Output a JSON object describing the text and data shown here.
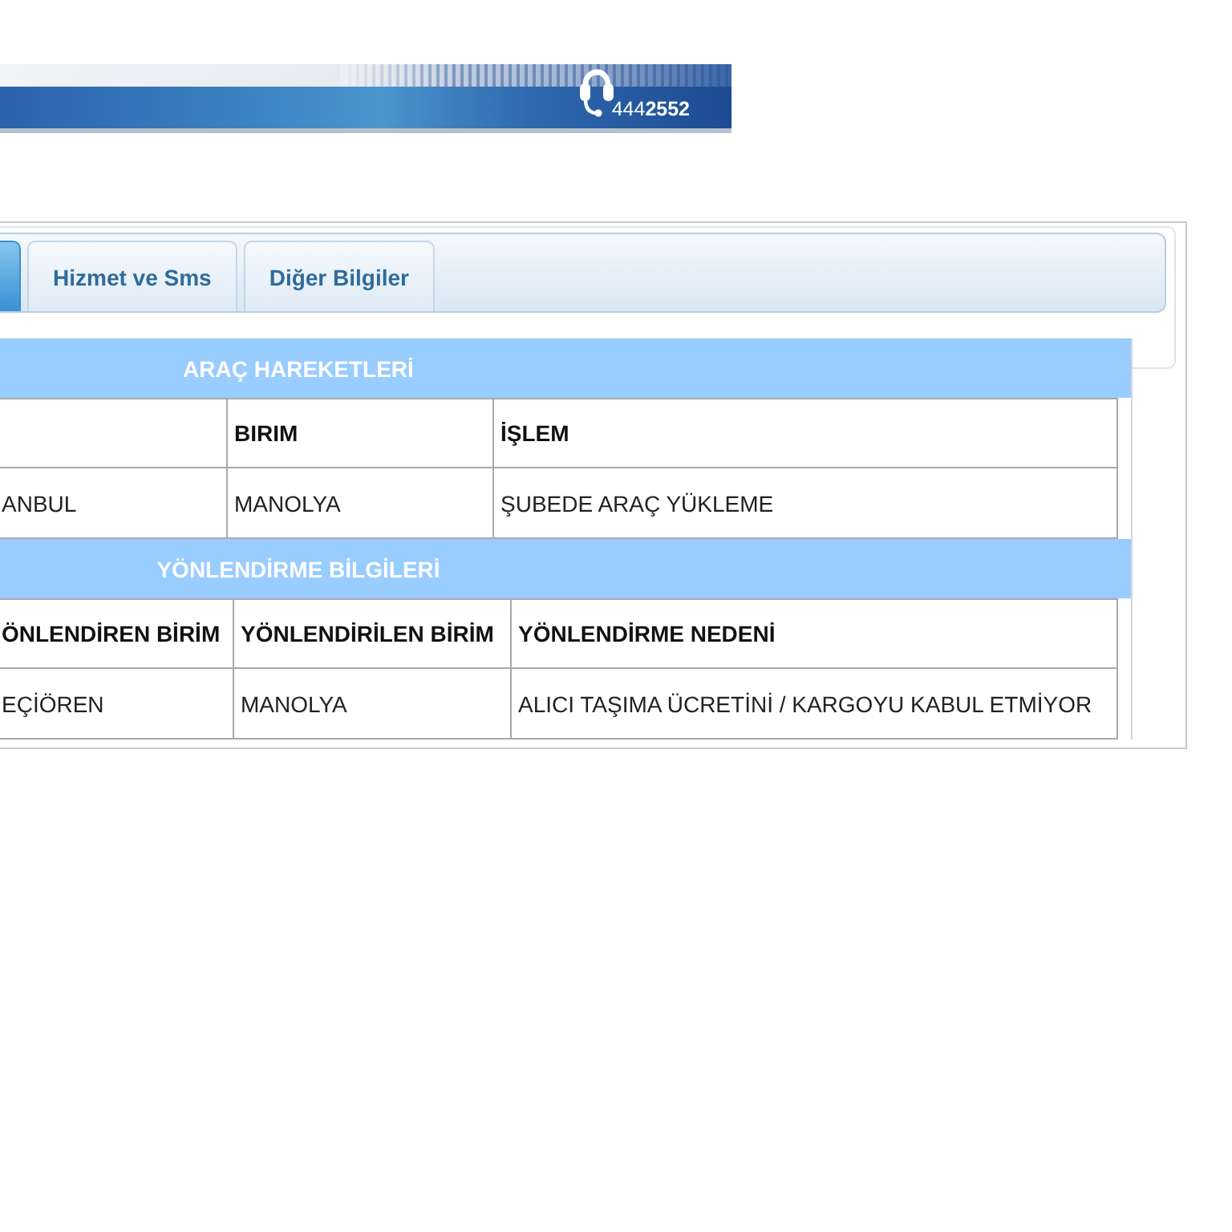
{
  "banner": {
    "phone": "444**2552**"
  },
  "tabs": [
    {
      "selected": true
    },
    {
      "label": "Hizmet ve Sms",
      "selected": false
    },
    {
      "label": "Diğer Bilgiler",
      "selected": false
    }
  ],
  "sections": [
    {
      "title": "ARAÇ HAREKETLERİ",
      "columns": [
        "",
        "BIRIM",
        "İŞLEM"
      ],
      "rows": [
        [
          "ANBUL",
          "MANOLYA",
          "ŞUBEDE ARAÇ YÜKLEME"
        ]
      ]
    },
    {
      "title": "YÖNLENDİRME BİLGİLERİ",
      "columns": [
        "ÖNLENDİREN BİRİM",
        "YÖNLENDİRİLEN BİRİM",
        "YÖNLENDİRME NEDENİ"
      ],
      "rows": [
        [
          "EÇİÖREN",
          "MANOLYA",
          "ALICI TAŞIMA ÜCRETİNİ / KARGOYU KABUL ETMİYOR"
        ]
      ]
    }
  ]
}
